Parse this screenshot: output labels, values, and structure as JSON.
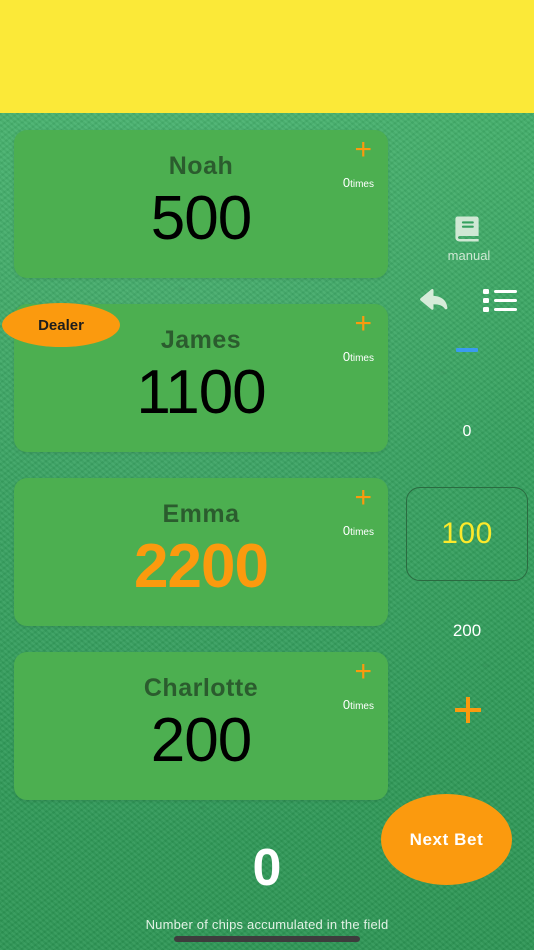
{
  "ad_banner": {
    "color": "#FBE938",
    "content": ""
  },
  "table": {
    "felt_color": "#35a05e",
    "card_color": "#4CAF50",
    "accent_color": "#FB9A0E",
    "chip_value_color": "#FCE92B"
  },
  "dealer": {
    "label": "Dealer",
    "player": "James"
  },
  "players": [
    {
      "name": "Noah",
      "value": "500",
      "times_count": "0",
      "times_unit": "times",
      "plus": "+",
      "highlighted": false
    },
    {
      "name": "James",
      "value": "1100",
      "times_count": "0",
      "times_unit": "times",
      "plus": "+",
      "highlighted": false
    },
    {
      "name": "Emma",
      "value": "2200",
      "times_count": "0",
      "times_unit": "times",
      "plus": "+",
      "highlighted": true
    },
    {
      "name": "Charlotte",
      "value": "200",
      "times_count": "0",
      "times_unit": "times",
      "plus": "+",
      "highlighted": false
    }
  ],
  "rail": {
    "manual_label": "manual",
    "manual_icon": "book-icon",
    "undo_icon": "undo-arrow-icon",
    "list_icon": "list-icon",
    "minus_icon": "minus-icon",
    "minus_color": "#3A9BF0",
    "bet_below": "0",
    "chip_value": "100",
    "bet_above": "200",
    "plus_icon": "plus-icon",
    "next_bet_label": "Next Bet"
  },
  "field": {
    "total": "0",
    "caption": "Number of chips accumulated in the field"
  }
}
